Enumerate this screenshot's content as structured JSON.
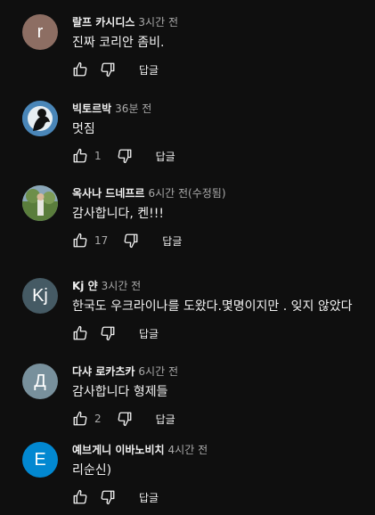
{
  "comments": [
    {
      "author": "랄프 카시디스",
      "time": "3시간 전",
      "text": "진짜 코리안 좀비.",
      "likes": "",
      "reply_label": "답글",
      "avatar_letter": "r",
      "avatar_color": "#8d6e63",
      "avatar_type": "letter"
    },
    {
      "author": "빅토르박",
      "time": "36분 전",
      "text": "멋짐",
      "likes": "1",
      "reply_label": "답글",
      "avatar_letter": "",
      "avatar_color": "#3b6e96",
      "avatar_type": "photo-silhouette"
    },
    {
      "author": "옥사나 드네프르",
      "time": "6시간 전(수정됨)",
      "text": "감사합니다, 켄!!!",
      "likes": "17",
      "reply_label": "답글",
      "avatar_letter": "",
      "avatar_color": "#5c7a4a",
      "avatar_type": "photo-landscape"
    },
    {
      "author": "Kj 얀",
      "time": "3시간 전",
      "text": "한국도 우크라이나를 도왔다.몇명이지만 . 잊지 않았다",
      "likes": "",
      "reply_label": "답글",
      "avatar_letter": "Kj",
      "avatar_color": "#455a64",
      "avatar_type": "letter"
    },
    {
      "author": "다샤 로카츠카",
      "time": "6시간 전",
      "text": "감사합니다 형제들",
      "likes": "2",
      "reply_label": "답글",
      "avatar_letter": "Д",
      "avatar_color": "#78909c",
      "avatar_type": "letter"
    },
    {
      "author": "예브게니 이바노비치",
      "time": "4시간 전",
      "text": "리순신)",
      "likes": "",
      "reply_label": "답글",
      "avatar_letter": "E",
      "avatar_color": "#0288d1",
      "avatar_type": "letter"
    }
  ]
}
